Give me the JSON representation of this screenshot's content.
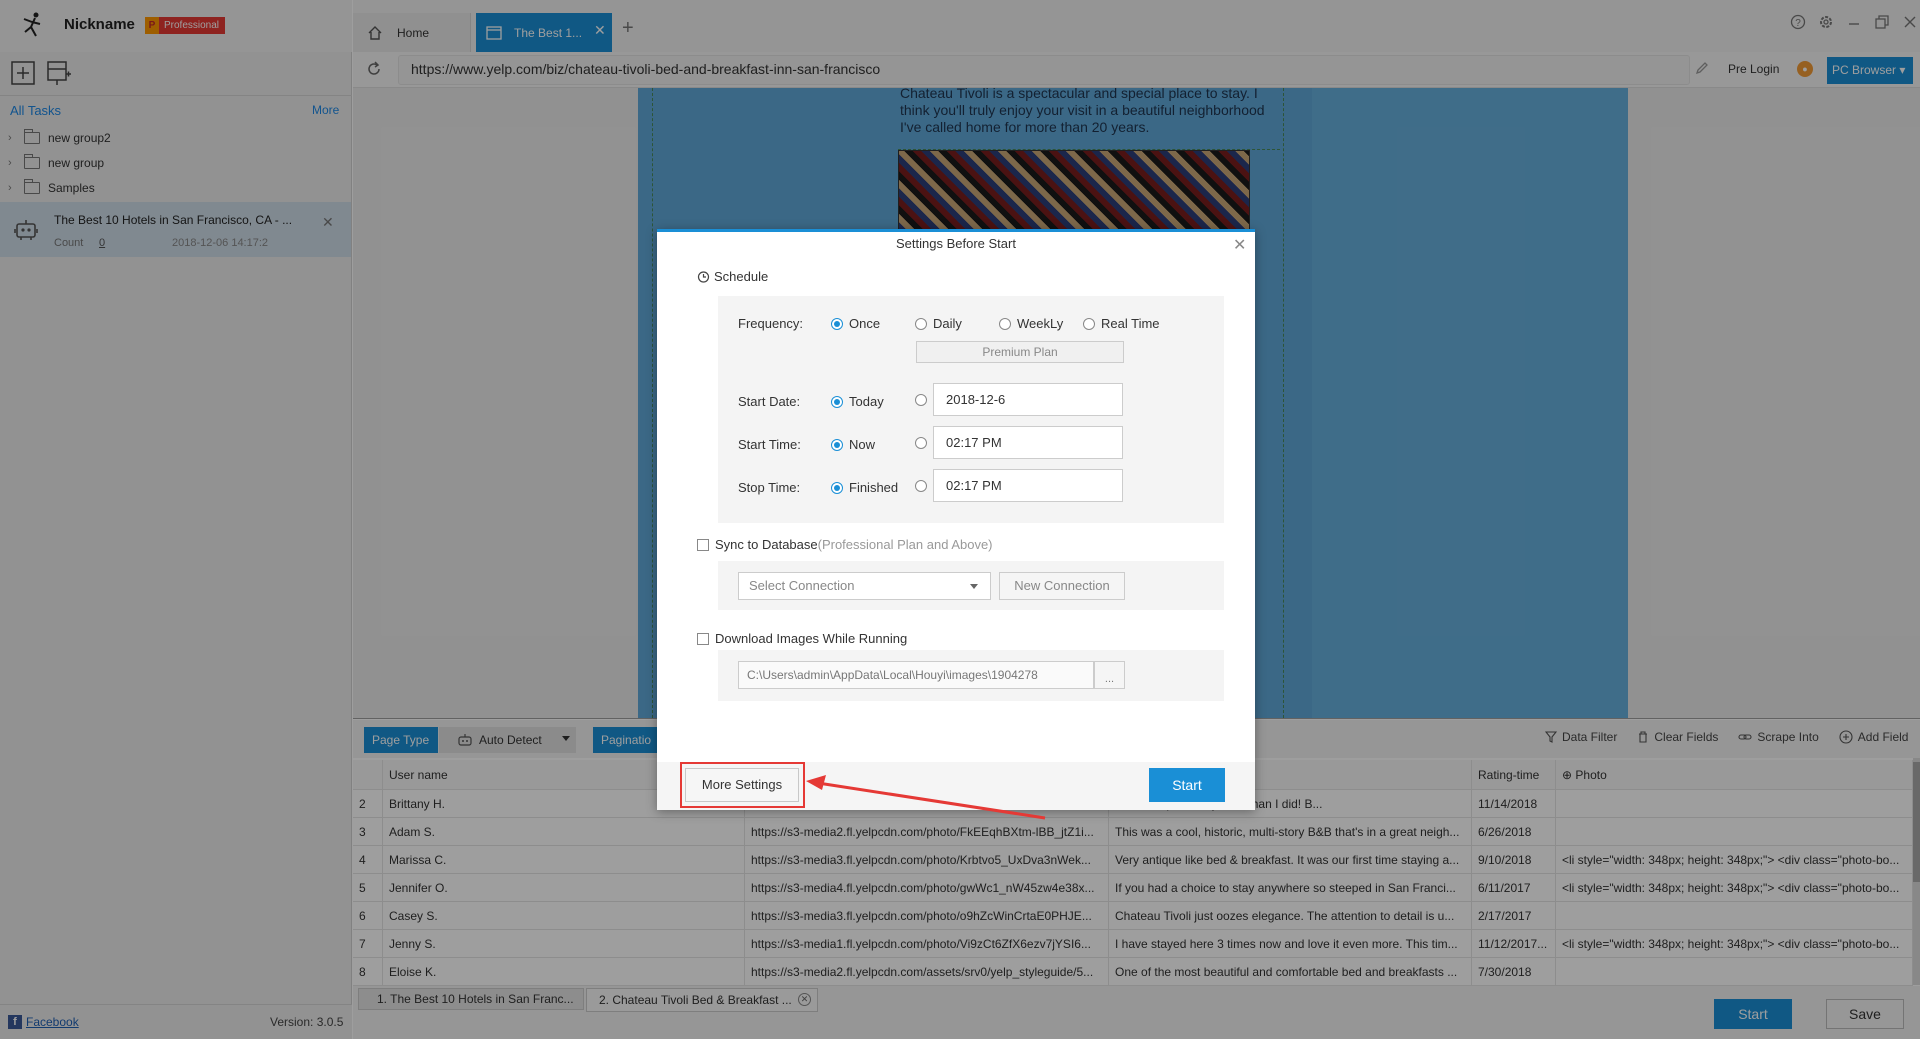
{
  "app": {
    "nickname": "Nickname",
    "plan_badge_letter": "P",
    "plan_badge": "Professional",
    "version": "Version: 3.0.5",
    "facebook": "Facebook"
  },
  "sidebar": {
    "all_tasks": "All Tasks",
    "more": "More",
    "groups": [
      "new group2",
      "new group",
      "Samples"
    ],
    "task": {
      "title": "The Best 10 Hotels in San Francisco, CA - ...",
      "count_label": "Count",
      "count": "0",
      "date": "2018-12-06 14:17:2"
    }
  },
  "tabs": {
    "home": "Home",
    "active": "The Best 1..."
  },
  "address": {
    "url": "https://www.yelp.com/biz/chateau-tivoli-bed-and-breakfast-inn-san-francisco",
    "pre_login": "Pre Login",
    "browser_mode": "PC Browser"
  },
  "webpage": {
    "text": "Chateau Tivoli is a spectacular and special place to stay. I think you'll truly enjoy your visit in a beautiful neighborhood I've called home for more than 20 years."
  },
  "toolbar": {
    "page_type": "Page Type",
    "auto_detect": "Auto Detect",
    "pagination": "Paginatio",
    "data_filter": "Data Filter",
    "clear_fields": "Clear Fields",
    "scrape_into": "Scrape Into",
    "add_field": "Add Field"
  },
  "grid": {
    "headers": [
      "",
      "User name",
      "",
      "",
      "Rating-time",
      "Photo"
    ],
    "rows": [
      [
        "2",
        "Brittany H.",
        "",
        "oved this place anymore than I did! B...",
        "11/14/2018",
        ""
      ],
      [
        "3",
        "Adam S.",
        "https://s3-media2.fl.yelpcdn.com/photo/FkEEqhBXtm-lBB_jtZ1i...",
        "This was a cool, historic, multi-story B&B that's in a great neigh...",
        "6/26/2018",
        ""
      ],
      [
        "4",
        "Marissa C.",
        "https://s3-media3.fl.yelpcdn.com/photo/Krbtvo5_UxDva3nWek...",
        "Very antique like bed & breakfast. It was our first time staying a...",
        "9/10/2018",
        "<li style=\"width: 348px; height: 348px;\"> <div class=\"photo-bo..."
      ],
      [
        "5",
        "Jennifer O.",
        "https://s3-media4.fl.yelpcdn.com/photo/gwWc1_nW45zw4e38x...",
        "If you had a choice to stay anywhere so steeped in San Franci...",
        "6/11/2017",
        "<li style=\"width: 348px; height: 348px;\"> <div class=\"photo-bo..."
      ],
      [
        "6",
        "Casey S.",
        "https://s3-media3.fl.yelpcdn.com/photo/o9hZcWinCrtaE0PHJE...",
        "Chateau Tivoli just oozes elegance. The attention to detail is u...",
        "2/17/2017",
        ""
      ],
      [
        "7",
        "Jenny S.",
        "https://s3-media1.fl.yelpcdn.com/photo/Vi9zCt6ZfX6ezv7jYSI6...",
        "I have stayed here 3 times now and love it even more. This tim...",
        "11/12/2017...",
        "<li style=\"width: 348px; height: 348px;\"> <div class=\"photo-bo..."
      ],
      [
        "8",
        "Eloise K.",
        "https://s3-media2.fl.yelpcdn.com/assets/srv0/yelp_styleguide/5...",
        "One of the most beautiful and comfortable bed and breakfasts ...",
        "7/30/2018",
        ""
      ]
    ]
  },
  "bottom_tabs": {
    "tab1": "1.  The Best 10 Hotels in San Franc...",
    "tab2": "2.  Chateau Tivoli Bed & Breakfast ..."
  },
  "actions": {
    "start": "Start",
    "save": "Save"
  },
  "modal": {
    "title": "Settings Before Start",
    "schedule": "Schedule",
    "frequency_label": "Frequency:",
    "frequency_options": [
      "Once",
      "Daily",
      "WeekLy",
      "Real Time"
    ],
    "premium_plan": "Premium Plan",
    "start_date_label": "Start Date:",
    "start_date_default": "Today",
    "start_date_value": "2018-12-6",
    "start_time_label": "Start Time:",
    "start_time_default": "Now",
    "start_time_value": "02:17  PM",
    "stop_time_label": "Stop Time:",
    "stop_time_default": "Finished",
    "stop_time_value": "02:17  PM",
    "sync_label": "Sync to Database",
    "sync_note": "(Professional Plan and Above)",
    "select_connection": "Select Connection",
    "new_connection": "New Connection",
    "download_label": "Download Images While Running",
    "download_path": "C:\\Users\\admin\\AppData\\Local\\Houyi\\images\\1904278",
    "browse": "...",
    "more_settings": "More Settings",
    "start": "Start"
  },
  "colors": {
    "accent": "#1a8fd6",
    "highlight": "#e53935",
    "badge": "#e53935"
  }
}
